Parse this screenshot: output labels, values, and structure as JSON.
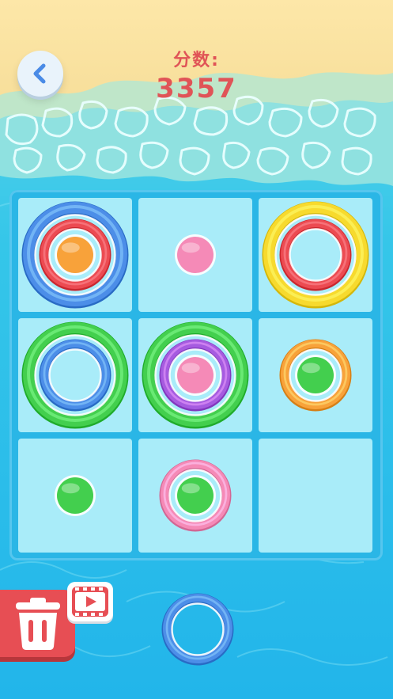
{
  "header": {
    "back_icon": "chevron-left-icon",
    "score_label": "分数:",
    "score_value": "3357"
  },
  "colors": {
    "blue": "#4c8ee8",
    "red": "#ec4b52",
    "yellow": "#f7da2e",
    "green": "#43cf4e",
    "purple": "#a65be0",
    "pink": "#f58ab7",
    "orange": "#f8a23a",
    "score_text": "#e05457",
    "board": "#2ab6e6",
    "cell": "#a9ecf9"
  },
  "board": {
    "rows": 3,
    "cols": 3,
    "cells": [
      {
        "row": 1,
        "col": 1,
        "large": "blue",
        "medium": "red",
        "small": "orange"
      },
      {
        "row": 1,
        "col": 2,
        "large": null,
        "medium": null,
        "small": "pink"
      },
      {
        "row": 1,
        "col": 3,
        "large": "yellow",
        "medium": "red",
        "small": null
      },
      {
        "row": 2,
        "col": 1,
        "large": "green",
        "medium": "blue",
        "small": null
      },
      {
        "row": 2,
        "col": 2,
        "large": "green",
        "medium": "purple",
        "small": "pink"
      },
      {
        "row": 2,
        "col": 3,
        "large": null,
        "medium": "orange",
        "small": "green"
      },
      {
        "row": 3,
        "col": 1,
        "large": null,
        "medium": null,
        "small": "green"
      },
      {
        "row": 3,
        "col": 2,
        "large": null,
        "medium": "pink",
        "small": "green"
      },
      {
        "row": 3,
        "col": 3,
        "large": null,
        "medium": null,
        "small": null
      }
    ]
  },
  "bottom_bar": {
    "trash_icon": "trash-icon",
    "video_icon": "video-ad-icon",
    "next_piece": {
      "large": null,
      "medium": "blue",
      "small": null
    }
  }
}
